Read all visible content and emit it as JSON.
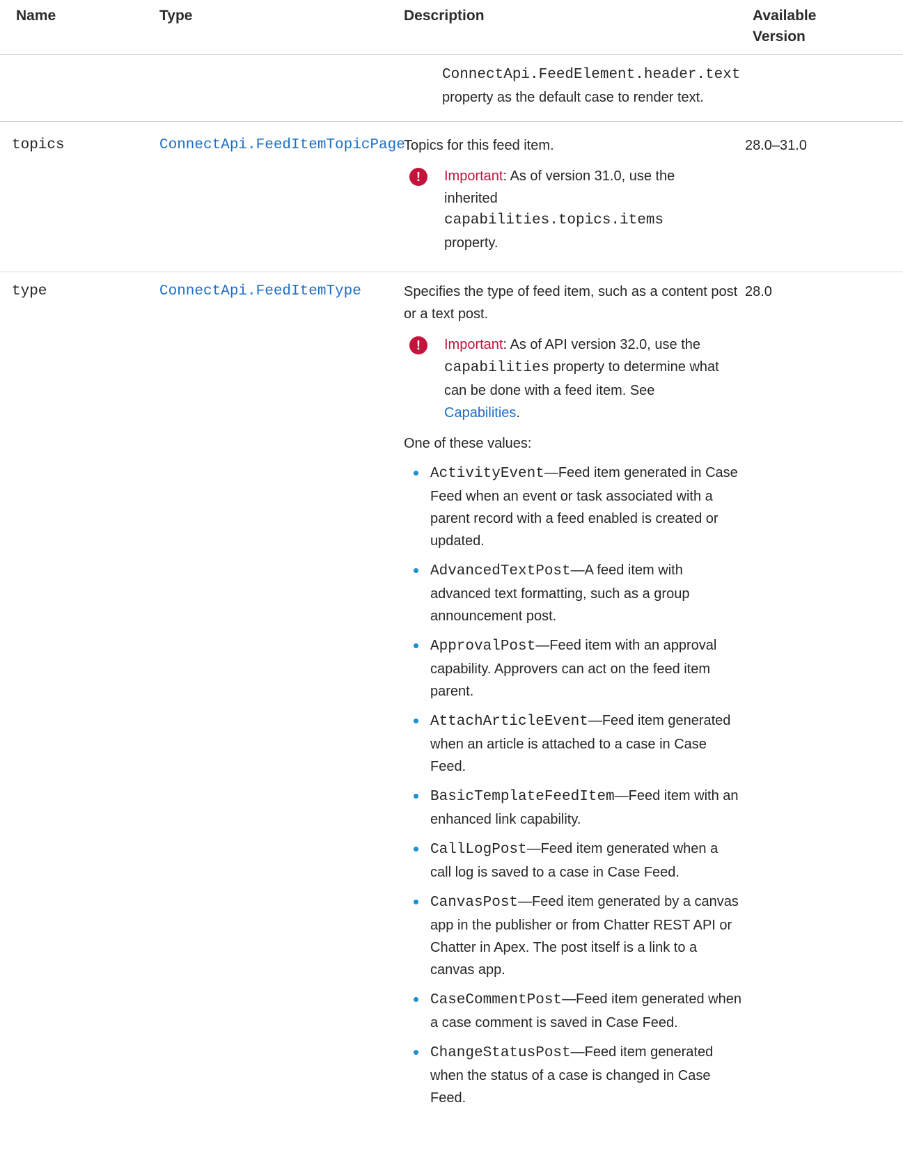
{
  "header": {
    "name": "Name",
    "type": "Type",
    "description": "Description",
    "version_line1": "Available",
    "version_line2": "Version"
  },
  "row0": {
    "code": "ConnectApi.FeedElement.header.text",
    "text": "property as the default case to render text."
  },
  "row_topics": {
    "name": "topics",
    "type": "ConnectApi.FeedItemTopicPage",
    "description": "Topics for this feed item.",
    "version": "28.0–31.0",
    "important_label": "Important",
    "important_text1": "As of version 31.0, use the inherited",
    "important_code": "capabilities.topics.items",
    "important_text2": "property."
  },
  "row_type": {
    "name": "type",
    "type": "ConnectApi.FeedItemType",
    "description": "Specifies the type of feed item, such as a content post or a text post.",
    "version": "28.0",
    "important_label": "Important",
    "important_text1": "As of API version 32.0, use the",
    "important_code": "capabilities",
    "important_text2": "property to determine what can be done with a feed item. See",
    "important_link": "Capabilities",
    "important_text3": ".",
    "values_intro": "One of these values:",
    "values": [
      {
        "code": "ActivityEvent",
        "text": "—Feed item generated in Case Feed when an event or task associated with a parent record with a feed enabled is created or updated."
      },
      {
        "code": "AdvancedTextPost",
        "text": "—A feed item with advanced text formatting, such as a group announcement post."
      },
      {
        "code": "ApprovalPost",
        "text": "—Feed item with an approval capability. Approvers can act on the feed item parent."
      },
      {
        "code": "AttachArticleEvent",
        "text": "—Feed item generated when an article is attached to a case in Case Feed."
      },
      {
        "code": "BasicTemplateFeedItem",
        "text": "—Feed item with an enhanced link capability."
      },
      {
        "code": "CallLogPost",
        "text": "—Feed item generated when a call log is saved to a case in Case Feed."
      },
      {
        "code": "CanvasPost",
        "text": "—Feed item generated by a canvas app in the publisher or from Chatter REST API or Chatter in Apex. The post itself is a link to a canvas app."
      },
      {
        "code": "CaseCommentPost",
        "text": "—Feed item generated when a case comment is saved in Case Feed."
      },
      {
        "code": "ChangeStatusPost",
        "text": "—Feed item generated when the status of a case is changed in Case Feed."
      }
    ]
  }
}
